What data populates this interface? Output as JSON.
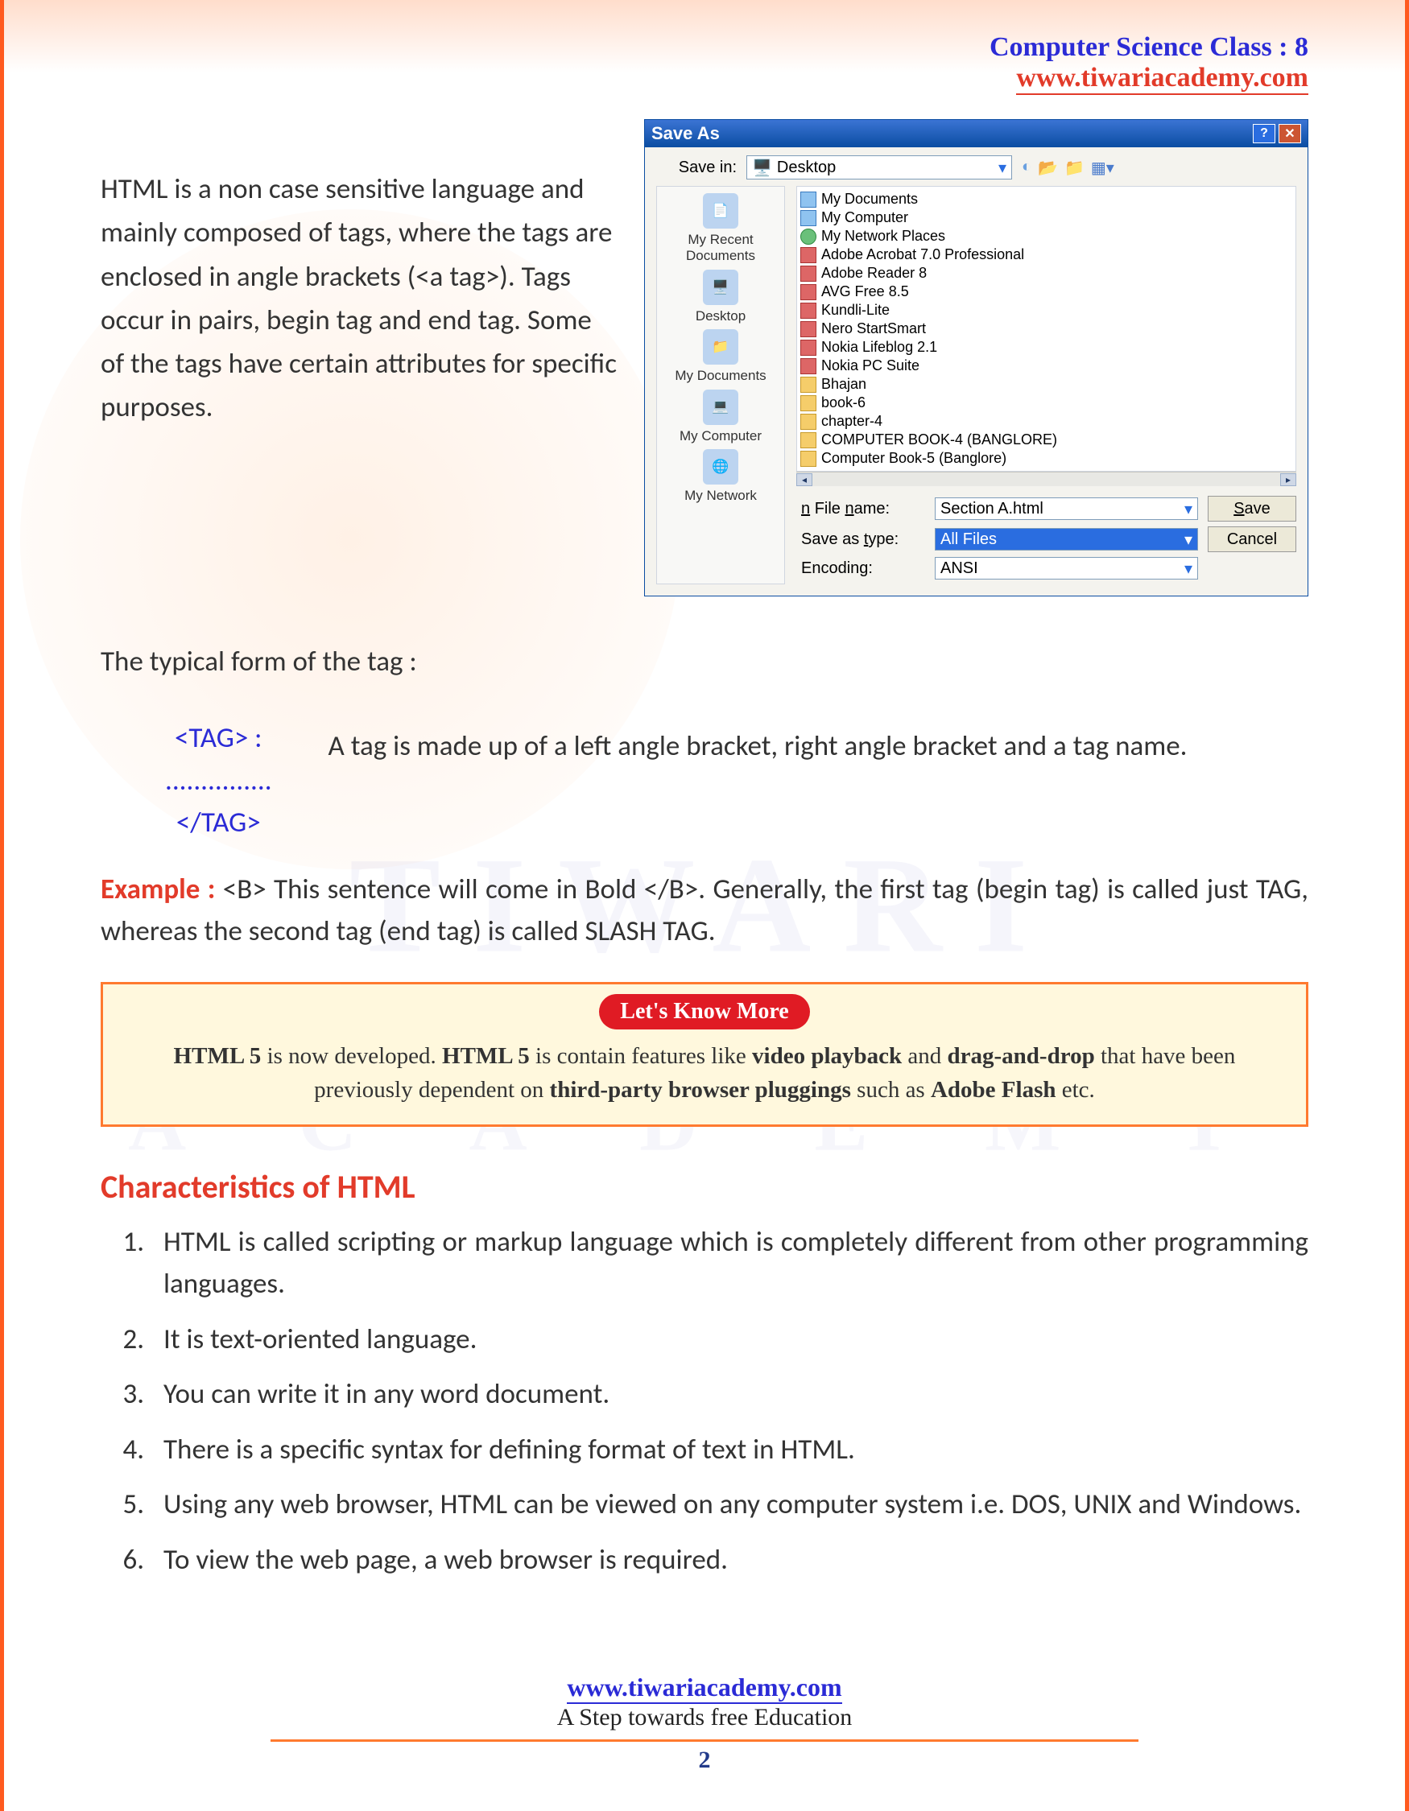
{
  "header": {
    "title": "Computer Science Class : 8",
    "url": "www.tiwariacademy.com"
  },
  "intro": "HTML is a non case sensitive language and mainly composed of tags, where the tags are enclosed in angle brackets (<a tag>). Tags occur in pairs, begin tag and end tag. Some of the tags have certain attributes for specific purposes.",
  "dialog": {
    "title": "Save As",
    "save_in_label": "Save in:",
    "save_in_value": "Desktop",
    "places": [
      "My Recent Documents",
      "Desktop",
      "My Documents",
      "My Computer",
      "My Network"
    ],
    "files": [
      {
        "icon": "doc",
        "name": "My Documents"
      },
      {
        "icon": "doc",
        "name": "My Computer"
      },
      {
        "icon": "glob",
        "name": "My Network Places"
      },
      {
        "icon": "app",
        "name": "Adobe Acrobat 7.0 Professional"
      },
      {
        "icon": "app",
        "name": "Adobe Reader 8"
      },
      {
        "icon": "app",
        "name": "AVG Free 8.5"
      },
      {
        "icon": "app",
        "name": "Kundli-Lite"
      },
      {
        "icon": "app",
        "name": "Nero StartSmart"
      },
      {
        "icon": "app",
        "name": "Nokia Lifeblog 2.1"
      },
      {
        "icon": "app",
        "name": "Nokia PC Suite"
      },
      {
        "icon": "fold",
        "name": "Bhajan"
      },
      {
        "icon": "fold",
        "name": "book-6"
      },
      {
        "icon": "fold",
        "name": "chapter-4"
      },
      {
        "icon": "fold",
        "name": "COMPUTER BOOK-4 (BANGLORE)"
      },
      {
        "icon": "fold",
        "name": "Computer Book-5 (Banglore)"
      }
    ],
    "filename_label": "File name:",
    "filename_value": "Section A.html",
    "savetype_label": "Save as type:",
    "savetype_value": "All Files",
    "encoding_label": "Encoding:",
    "encoding_value": "ANSI",
    "save_btn": "Save",
    "cancel_btn": "Cancel"
  },
  "tag_form": {
    "heading": "The typical form of the tag :",
    "open": "<TAG> :",
    "dots": "...............",
    "close": "</TAG>",
    "desc": "A tag is made up of a left angle bracket, right angle bracket and a tag name."
  },
  "example": {
    "label": "Example :",
    "text": " <B> This sentence will come in Bold </B>. Generally, the first tag (begin tag) is called just TAG, whereas the second tag (end tag) is called SLASH TAG."
  },
  "know_more": {
    "pill": "Let's Know More",
    "b1": "HTML 5",
    "t1": " is now developed. ",
    "b2": "HTML 5",
    "t2": " is contain features like ",
    "b3": "video playback",
    "t3": " and ",
    "b4": "drag-and-drop",
    "t4": " that have been previously dependent on ",
    "b5": "third-party browser pluggings",
    "t5": " such as ",
    "b6": "Adobe Flash",
    "t6": " etc."
  },
  "section_heading": "Characteristics of HTML",
  "characteristics": [
    "HTML is called scripting or markup language which is completely different from other programming languages.",
    "It is text-oriented language.",
    "You can write it in any word document.",
    "There is a specific syntax for defining format of text in HTML.",
    "Using any web browser, HTML can be viewed on any computer system i.e. DOS, UNIX and Windows.",
    "To view the web page, a web browser is required."
  ],
  "footer": {
    "url": "www.tiwariacademy.com",
    "tagline": "A Step towards free Education",
    "page_no": "2"
  },
  "watermark": {
    "big": "TIWARI",
    "small": "A C A D E M Y"
  }
}
